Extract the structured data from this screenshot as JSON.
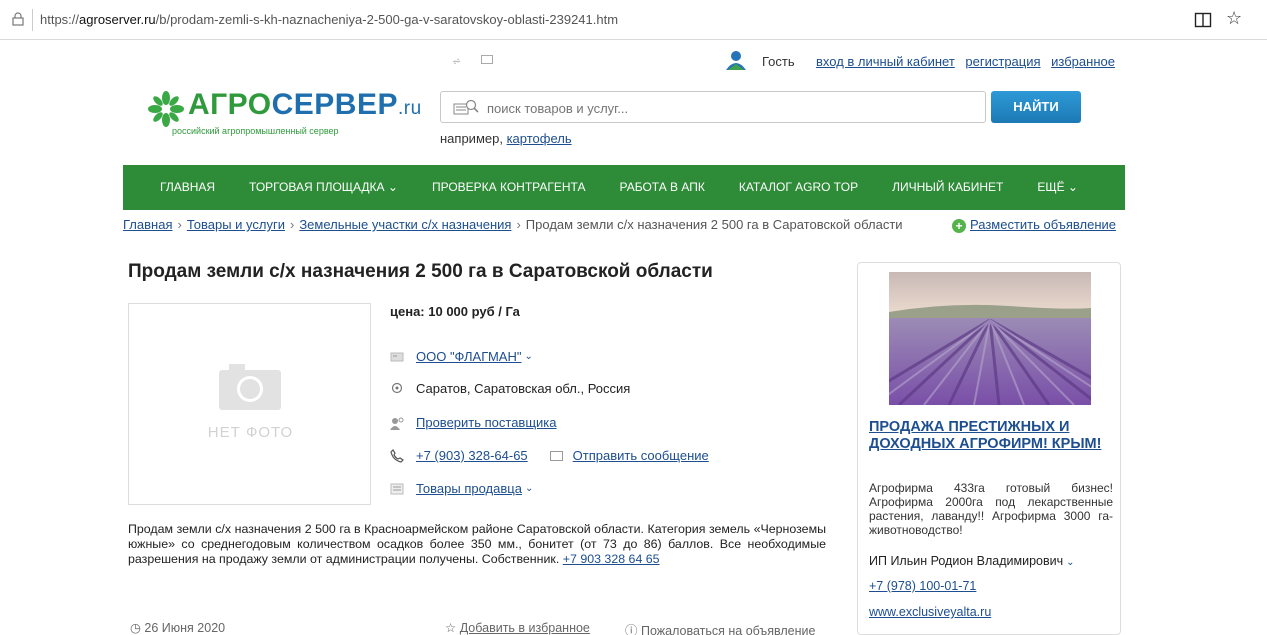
{
  "browser": {
    "url_prefix": "https://",
    "url_host": "agroserver.ru",
    "url_path": "/b/prodam-zemli-s-kh-naznacheniya-2-500-ga-v-saratovskoy-oblasti-239241.htm"
  },
  "header": {
    "guest_label": "Гость",
    "login_link": "вход в личный кабинет",
    "register_link": "регистрация",
    "favorites_link": "избранное",
    "logo_green": "АГРО",
    "logo_blue": "СЕРВЕР",
    "logo_ru": ".ru",
    "logo_subtitle": "российский агропромышленный сервер",
    "search_placeholder": "поиск товаров и услуг...",
    "search_button": "НАЙТИ",
    "example_label": "например,",
    "example_link": "картофель"
  },
  "nav": {
    "items": [
      {
        "label": "ГЛАВНАЯ"
      },
      {
        "label": "ТОРГОВАЯ ПЛОЩАДКА ⌄"
      },
      {
        "label": "ПРОВЕРКА КОНТРАГЕНТА"
      },
      {
        "label": "РАБОТА В АПК"
      },
      {
        "label": "КАТАЛОГ AGRO TOP"
      },
      {
        "label": "ЛИЧНЫЙ КАБИНЕТ"
      },
      {
        "label": "ЕЩЁ ⌄"
      }
    ]
  },
  "breadcrumb": {
    "home": "Главная",
    "goods": "Товары и услуги",
    "category": "Земельные участки с/х назначения",
    "current": "Продам земли с/х назначения 2 500 га в Саратовской области",
    "place_ad": "Разместить объявление"
  },
  "listing": {
    "title": "Продам земли с/х назначения 2 500 га в Саратовской области",
    "no_photo": "НЕТ ФОТО",
    "price": "цена: 10 000 руб / Га",
    "company": "ООО \"ФЛАГМАН\"",
    "location": "Саратов, Саратовская обл., Россия",
    "check_supplier": "Проверить поставщика",
    "phone": "+7 (903) 328-64-65",
    "send_message": "Отправить сообщение",
    "seller_goods": "Товары продавца",
    "description": "Продам земли с/х назначения 2 500 га в Красноармейском районе Саратовской области. Категория земель «Черноземы южные» со среднегодовым количеством осадков более 350 мм., бонитет (от 73 до 86) баллов. Все необходимые разрешения на продажу земли от администрации получены. Собственник.",
    "description_phone": "+7 903 328 64 65",
    "date": "26 Июня 2020",
    "add_favorite": "Добавить в избранное",
    "complain": "Пожаловаться на объявление"
  },
  "ad": {
    "title": "ПРОДАЖА ПРЕСТИЖНЫХ И ДОХОДНЫХ АГРОФИРМ! КРЫМ!",
    "text": "Агрофирма 433га готовый бизнес! Агрофирма 2000га под лекарственные растения, лаванду!! Агрофирма 3000 га- животноводство!",
    "seller": "ИП Ильин Родион Владимирович",
    "phone": "+7 (978) 100-01-71",
    "site": "www.exclusiveyalta.ru"
  },
  "colors": {
    "nav_green": "#2e8b38",
    "link_blue": "#1d4e8f",
    "button_blue": "#1c79b5",
    "logo_green": "#2f9a3c"
  }
}
